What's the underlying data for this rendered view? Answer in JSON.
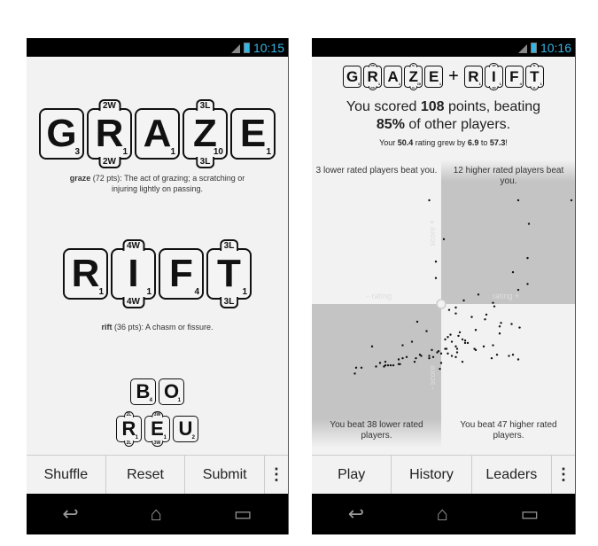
{
  "status": {
    "network": "3G",
    "time_left": "10:15",
    "time_right": "10:16",
    "accent": "#33b5e5"
  },
  "words": [
    {
      "tiles": [
        {
          "l": "G",
          "p": "3"
        },
        {
          "l": "R",
          "p": "1",
          "b": "2W"
        },
        {
          "l": "A",
          "p": "1"
        },
        {
          "l": "Z",
          "p": "10",
          "b": "3L"
        },
        {
          "l": "E",
          "p": "1"
        }
      ],
      "def_word": "graze",
      "def_pts": " (72 pts): The act of grazing; a scratching or injuring lightly on passing."
    },
    {
      "tiles": [
        {
          "l": "R",
          "p": "1"
        },
        {
          "l": "I",
          "p": "1",
          "b": "4W"
        },
        {
          "l": "F",
          "p": "4"
        },
        {
          "l": "T",
          "p": "1",
          "b": "3L"
        }
      ],
      "def_word": "rift",
      "def_pts": " (36 pts): A chasm or fissure."
    }
  ],
  "rack": [
    [
      {
        "l": "B",
        "p": "4"
      },
      {
        "l": "O",
        "p": "1"
      }
    ],
    [
      {
        "l": "R",
        "p": "1",
        "b": "2L"
      },
      {
        "l": "E",
        "p": "1",
        "b": "3W"
      },
      {
        "l": "U",
        "p": "2"
      }
    ]
  ],
  "left_buttons": [
    "Shuffle",
    "Reset",
    "Submit"
  ],
  "right_buttons": [
    "Play",
    "History",
    "Leaders"
  ],
  "more_glyph": "⋮",
  "nav": {
    "back": "↩",
    "home": "⌂",
    "recent": "▭"
  },
  "result": {
    "plus": "+",
    "line1a": "You scored ",
    "points": "108",
    "line1b": " points, beating",
    "percent": "85%",
    "line2b": " of other players.",
    "r1": "Your ",
    "old": "50.4",
    "r2": " rating grew by ",
    "delta": "6.9",
    "r3": " to ",
    "new": "57.3",
    "r4": "!"
  },
  "chart_data": {
    "type": "scatter",
    "xlabel_neg": "- rating",
    "xlabel_pos": "rating +",
    "ylabel_pos": "score +",
    "ylabel_neg": "- score",
    "quadrants": {
      "top_left": "3 lower rated players beat you.",
      "top_right": "12 higher rated players beat you.",
      "bottom_left": "You beat 38 lower rated players.",
      "bottom_right": "You beat 47 higher rated players."
    },
    "xlim": [
      -1,
      1
    ],
    "ylim": [
      -1,
      1
    ],
    "you": [
      0,
      0
    ],
    "points": [
      [
        -0.09,
        0.88
      ],
      [
        0.58,
        0.88
      ],
      [
        0.98,
        0.88
      ],
      [
        0.66,
        0.68
      ],
      [
        0.02,
        0.55
      ],
      [
        -0.04,
        0.36
      ],
      [
        -0.04,
        0.22
      ],
      [
        0.65,
        0.39
      ],
      [
        0.54,
        0.27
      ],
      [
        0.65,
        0.17
      ],
      [
        0.58,
        0.12
      ],
      [
        0.28,
        0.08
      ],
      [
        0.17,
        0.03
      ],
      [
        0.39,
        0.01
      ],
      [
        0.4,
        -0.02
      ],
      [
        0.06,
        -0.05
      ],
      [
        0.11,
        -0.03
      ],
      [
        0.11,
        -0.08
      ],
      [
        0.23,
        -0.11
      ],
      [
        0.34,
        -0.09
      ],
      [
        0.33,
        -0.13
      ],
      [
        0.45,
        -0.16
      ],
      [
        0.44,
        -0.19
      ],
      [
        0.53,
        -0.17
      ],
      [
        0.59,
        -0.2
      ],
      [
        0.44,
        -0.25
      ],
      [
        0.26,
        -0.22
      ],
      [
        -0.18,
        -0.15
      ],
      [
        -0.11,
        -0.23
      ],
      [
        0.14,
        -0.24
      ],
      [
        0.07,
        -0.26
      ],
      [
        0.05,
        -0.28
      ],
      [
        0.03,
        -0.3
      ],
      [
        0.13,
        -0.27
      ],
      [
        0.16,
        -0.3
      ],
      [
        0.18,
        -0.31
      ],
      [
        0.18,
        -0.33
      ],
      [
        0.2,
        -0.33
      ],
      [
        0.08,
        -0.32
      ],
      [
        0.11,
        -0.36
      ],
      [
        0.12,
        -0.38
      ],
      [
        0.04,
        -0.38
      ],
      [
        0.03,
        -0.38
      ],
      [
        0.12,
        -0.41
      ],
      [
        0.08,
        -0.44
      ],
      [
        0.11,
        -0.45
      ],
      [
        0.05,
        -0.42
      ],
      [
        0.0,
        -0.42
      ],
      [
        -0.03,
        -0.41
      ],
      [
        -0.02,
        -0.4
      ],
      [
        -0.07,
        -0.39
      ],
      [
        0.25,
        -0.38
      ],
      [
        0.26,
        -0.39
      ],
      [
        0.32,
        -0.36
      ],
      [
        0.39,
        -0.35
      ],
      [
        0.42,
        -0.43
      ],
      [
        0.38,
        -0.46
      ],
      [
        0.51,
        -0.44
      ],
      [
        0.54,
        -0.43
      ],
      [
        0.58,
        -0.47
      ],
      [
        0.16,
        -0.49
      ],
      [
        0.0,
        -0.5
      ],
      [
        -0.01,
        -0.55
      ],
      [
        -0.06,
        -0.45
      ],
      [
        -0.09,
        -0.44
      ],
      [
        -0.09,
        -0.46
      ],
      [
        -0.16,
        -0.43
      ],
      [
        -0.15,
        -0.44
      ],
      [
        -0.19,
        -0.46
      ],
      [
        -0.2,
        -0.49
      ],
      [
        -0.26,
        -0.45
      ],
      [
        -0.29,
        -0.46
      ],
      [
        -0.32,
        -0.47
      ],
      [
        -0.32,
        -0.51
      ],
      [
        -0.31,
        -0.51
      ],
      [
        -0.36,
        -0.52
      ],
      [
        -0.38,
        -0.52
      ],
      [
        -0.4,
        -0.52
      ],
      [
        -0.42,
        -0.52
      ],
      [
        -0.43,
        -0.53
      ],
      [
        -0.42,
        -0.49
      ],
      [
        -0.46,
        -0.5
      ],
      [
        -0.49,
        -0.53
      ],
      [
        -0.52,
        -0.36
      ],
      [
        -0.29,
        -0.35
      ],
      [
        -0.22,
        -0.32
      ],
      [
        -0.6,
        -0.54
      ],
      [
        -0.64,
        -0.54
      ],
      [
        -0.65,
        -0.59
      ]
    ]
  }
}
